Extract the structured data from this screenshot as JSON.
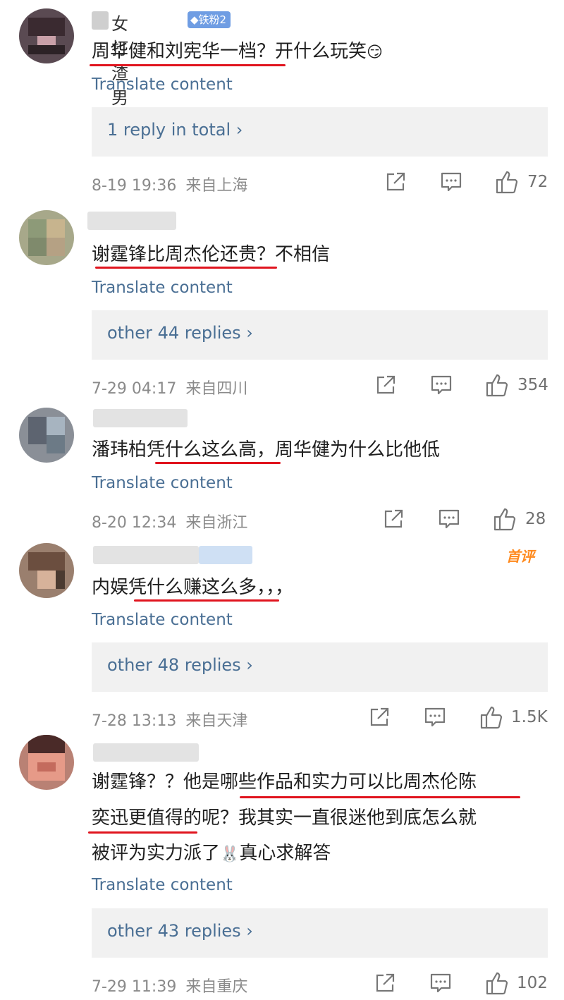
{
  "colors": {
    "link": "#4a6f94",
    "underline": "#e0141e",
    "meta": "#8a8a8a",
    "reply_bg": "#f1f1f1",
    "first_badge": "#ff8a1e"
  },
  "comments": [
    {
      "username": "女打渣男",
      "fan_badge": "铁粉2",
      "text": [
        "周华健和刘宪华一档？开什么玩笑"
      ],
      "emoji": "😏",
      "translate": "Translate content",
      "replies": "1 reply in total ›",
      "date": "8-19 19:36",
      "location": "来自上海",
      "likes": "72"
    },
    {
      "text": [
        "谢霆锋比周杰伦还贵？不相信"
      ],
      "translate": "Translate content",
      "replies": "other 44 replies ›",
      "date": "7-29 04:17",
      "location": "来自四川",
      "likes": "354"
    },
    {
      "text": [
        "潘玮柏凭什么这么高，周华健为什么比他低"
      ],
      "translate": "Translate content",
      "date": "8-20 12:34",
      "location": "来自浙江",
      "likes": "28"
    },
    {
      "first_badge": "首评",
      "text": [
        "内娱凭什么赚这么多，，，"
      ],
      "translate": "Translate content",
      "replies": "other 48 replies ›",
      "date": "7-28 13:13",
      "location": "来自天津",
      "likes": "1.5K"
    },
    {
      "text": [
        "谢霆锋？？他是哪些作品和实力可以比周杰伦陈",
        "奕迅更值得的呢？我其实一直很迷他到底怎么就",
        "被评为实力派了",
        "真心求解答"
      ],
      "emoji": "🐰",
      "translate": "Translate content",
      "replies": "other 43 replies ›",
      "date": "7-29 11:39",
      "location": "来自重庆",
      "likes": "102"
    }
  ]
}
